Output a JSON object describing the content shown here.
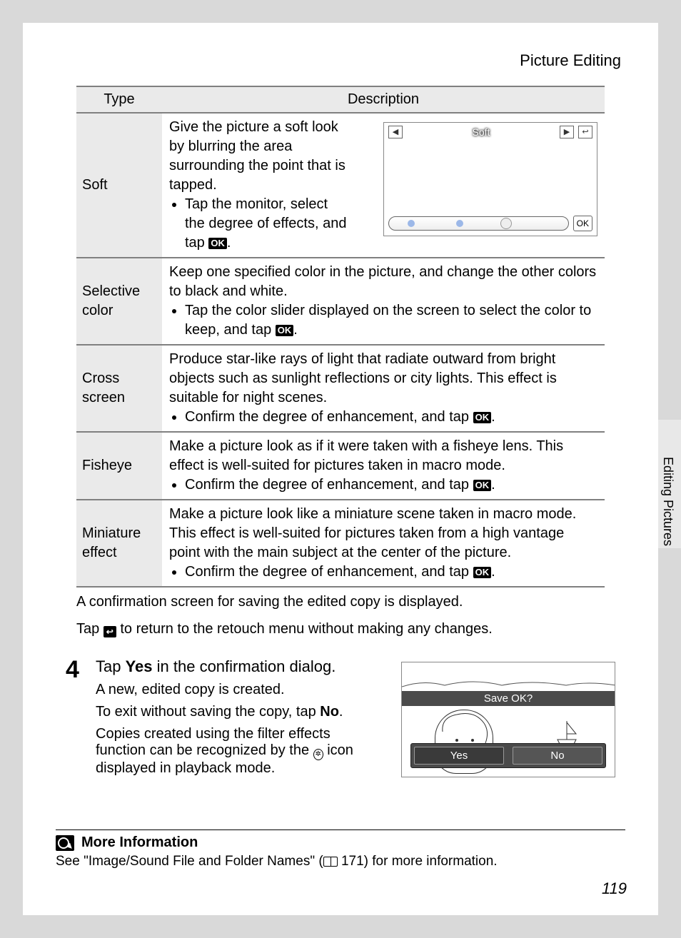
{
  "header": {
    "title": "Picture Editing"
  },
  "table": {
    "head": {
      "type": "Type",
      "desc": "Description"
    },
    "rows": {
      "soft": {
        "type": "Soft",
        "desc": "Give the picture a soft look by blurring the area surrounding the point that is tapped.",
        "bullet": "Tap the monitor, select the degree of effects, and tap ",
        "sim_label": "Soft",
        "sim_ok": "OK"
      },
      "selective": {
        "type": "Selective color",
        "desc": "Keep one specified color in the picture, and change the other colors to black and white.",
        "bullet": "Tap the color slider displayed on the screen to select the color to keep, and tap "
      },
      "cross": {
        "type": "Cross screen",
        "desc": "Produce star-like rays of light that radiate outward from bright objects such as sunlight reflections or city lights. This effect is suitable for night scenes.",
        "bullet": "Confirm the degree of enhancement, and tap "
      },
      "fisheye": {
        "type": "Fisheye",
        "desc": "Make a picture look as if it were taken with a fisheye lens. This effect is well-suited for pictures taken in macro mode.",
        "bullet": "Confirm the degree of enhancement, and tap "
      },
      "miniature": {
        "type": "Miniature effect",
        "desc": "Make a picture look like a miniature scene taken in macro mode. This effect is well-suited for pictures taken from a high vantage point with the main subject at the center of the picture.",
        "bullet": "Confirm the degree of enhancement, and tap "
      }
    }
  },
  "ok_label": "OK",
  "after": {
    "line1": "A confirmation screen for saving the edited copy is displayed.",
    "line2a": "Tap ",
    "line2b": " to return to the retouch menu without making any changes."
  },
  "step4": {
    "num": "4",
    "title_a": "Tap ",
    "title_b": "Yes",
    "title_c": " in the confirmation dialog.",
    "p1": "A new, edited copy is created.",
    "p2a": "To exit without saving the copy, tap ",
    "p2b": "No",
    "p2c": ".",
    "p3a": "Copies created using the filter effects function can be recognized by the ",
    "p3b": " icon displayed in playback mode.",
    "dialog": {
      "prompt": "Save OK?",
      "yes": "Yes",
      "no": "No"
    }
  },
  "side_tab": "Editing Pictures",
  "more": {
    "head": "More Information",
    "text_a": "See \"Image/Sound File and Folder Names\" (",
    "text_b": "171) for more information."
  },
  "page_number": "119"
}
